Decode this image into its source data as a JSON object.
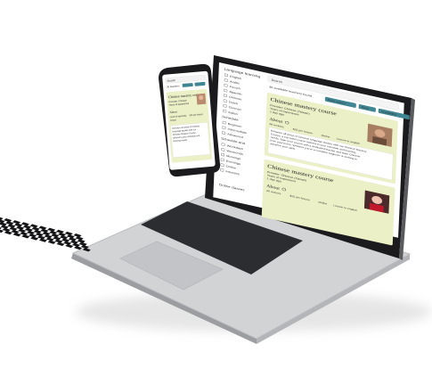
{
  "laptop": {
    "sidebar": {
      "heading": "Language learning",
      "languages": [
        "English",
        "Arabic",
        "French",
        "Spanish",
        "Chinese",
        "Dutch",
        "German",
        "Italian"
      ],
      "section2": "Schedule",
      "levels": [
        "Beginner",
        "Intermediate",
        "Advanced"
      ],
      "section3": "Schedule and",
      "times": [
        "Weekdays",
        "Weekends",
        "Mornings",
        "Evenings",
        "Online",
        "Intensive"
      ],
      "section4": "Online classes"
    },
    "search_placeholder": "Search",
    "results_label": "36 available teachers found",
    "filters": [
      "Price sorted",
      "Price",
      "Availability"
    ],
    "courses": [
      {
        "title": "Chinese mastery course",
        "provider": "Provider: Chinese (Taiwan)",
        "years": "Years of experience",
        "duration": "1 day ago",
        "about_label": "About",
        "stats": [
          "All reviews",
          "$25 per lesson",
          "Online",
          "Lesson in english"
        ],
        "description": "Enhance all areas of Chinese language studies with our Chinese Mastery Course, a top-rated course tailored to your schedule and learning needs. Start your course with a dedicated teacher and learn Chinese from your home. Whether you're a complete beginner or looking to advance your skills"
      },
      {
        "title": "Chinese mastery course",
        "provider": "Provider: Chinese (Taiwan)",
        "years": "Years of experience",
        "duration": "1 day ago",
        "about_label": "About",
        "stats": [
          "All reviews",
          "$25 per lesson",
          "Online",
          "Lesson in english"
        ]
      }
    ]
  },
  "phone": {
    "search_placeholder": "Search",
    "results_label": "36 teachers",
    "course": {
      "title": "Chinese mastery course",
      "provider": "Provider: Chinese",
      "years": "Years of experience",
      "about_label": "About",
      "stats": [
        "Level of speciality",
        "$25 per lesson",
        "Online"
      ],
      "description": "Enhance all areas of Chinese language studies with our Chinese Mastery Course, tailored to your schedule and learning needs."
    }
  },
  "colors": {
    "card_bg": "#ecf0c6",
    "accent": "#3f8592",
    "laptop_body": "#c9cacc",
    "bezel": "#1b1b1d"
  }
}
